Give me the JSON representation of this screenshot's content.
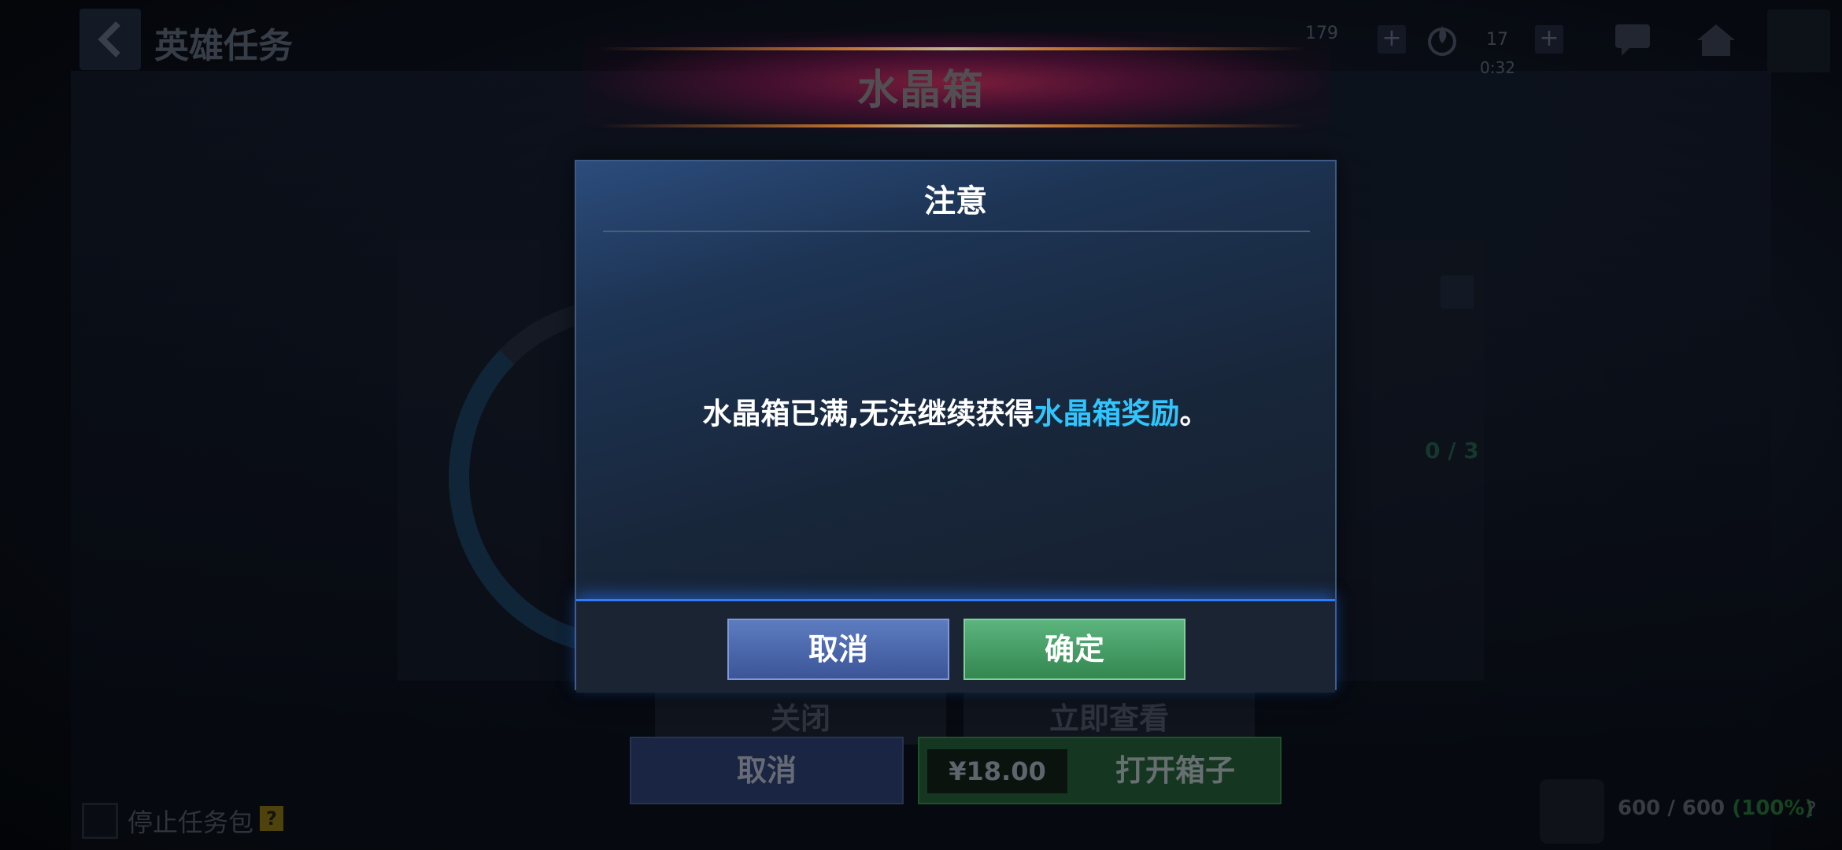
{
  "header": {
    "back_icon": "chevron-left-icon",
    "title": "英雄任务",
    "resource_1_value": "179",
    "energy_value": "17",
    "energy_timer": "0:32",
    "icons": [
      "chat-icon",
      "home-icon",
      "menu-icon",
      "fire-icon"
    ]
  },
  "banner": {
    "title": "水晶箱"
  },
  "background": {
    "progress": "0 / 3",
    "close_label": "关闭",
    "view_now_label": "立即查看"
  },
  "bottom_bar": {
    "cancel_label": "取消",
    "price": "¥18.00",
    "open_label": "打开箱子",
    "stop_pack_label": "停止任务包",
    "help_badge": "?",
    "capacity": "600 / 600",
    "capacity_pct": "(100%)",
    "help_q": "?"
  },
  "dialog": {
    "title": "注意",
    "message_prefix": "水晶箱已满,无法继续获得",
    "message_highlight": "水晶箱奖励",
    "message_suffix": "。",
    "cancel_label": "取消",
    "confirm_label": "确定"
  },
  "colors": {
    "highlight": "#2fc6ff",
    "cancel_button": "#4a66ad",
    "confirm_button": "#469a63",
    "dialog_bg": "#1d3454"
  }
}
